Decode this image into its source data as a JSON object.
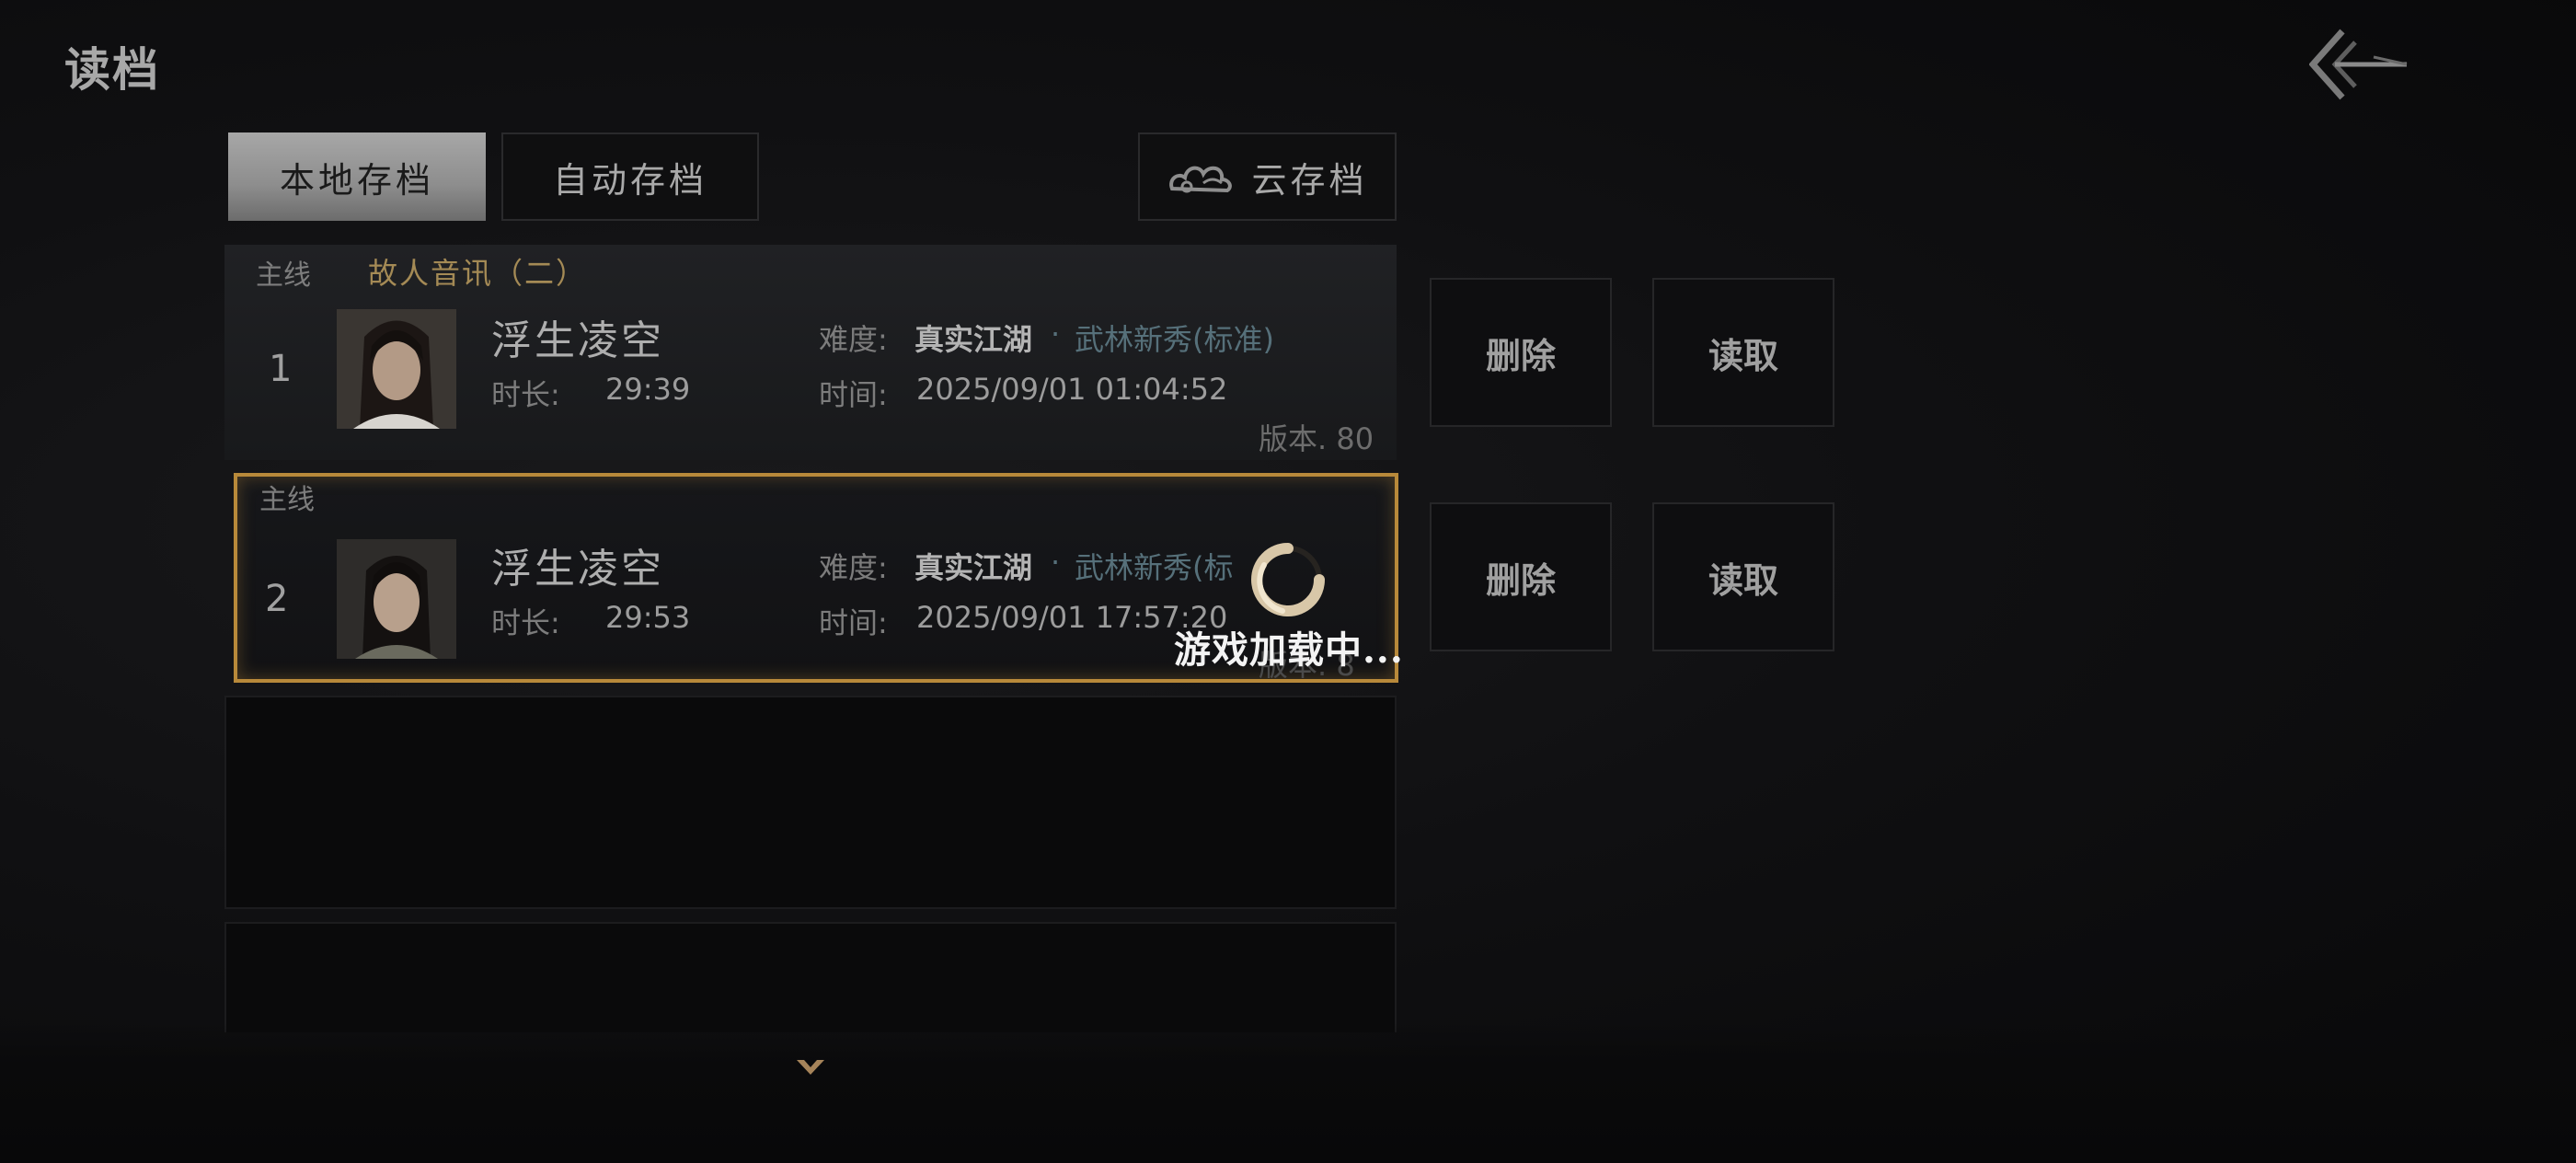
{
  "page": {
    "title": "读档"
  },
  "tabs": {
    "local": "本地存档",
    "auto": "自动存档",
    "cloud": "云存档"
  },
  "labels": {
    "difficulty": "难度:",
    "duration": "时长:",
    "time": "时间:"
  },
  "saves": [
    {
      "slot": "1",
      "chapter_label": "主线",
      "chapter_name": "故人音讯（二）",
      "name": "浮生凌空",
      "duration": "29:39",
      "difficulty_main": "真实江湖",
      "difficulty_sep": "·",
      "difficulty_sub": "武林新秀(标准)",
      "time": "2025/09/01 01:04:52",
      "version": "版本. 80",
      "delete_label": "删除",
      "load_label": "读取"
    },
    {
      "slot": "2",
      "chapter_label": "主线",
      "chapter_name": "",
      "name": "浮生凌空",
      "duration": "29:53",
      "difficulty_main": "真实江湖",
      "difficulty_sep": "·",
      "difficulty_sub": "武林新秀(标",
      "time": "2025/09/01 17:57:20",
      "version": "版本. 8",
      "delete_label": "删除",
      "load_label": "读取"
    }
  ],
  "loading": {
    "text": "游戏加载中..."
  },
  "colors": {
    "accent": "#b8893a",
    "blue_text": "#56707a",
    "gold_text": "#a48a55"
  }
}
